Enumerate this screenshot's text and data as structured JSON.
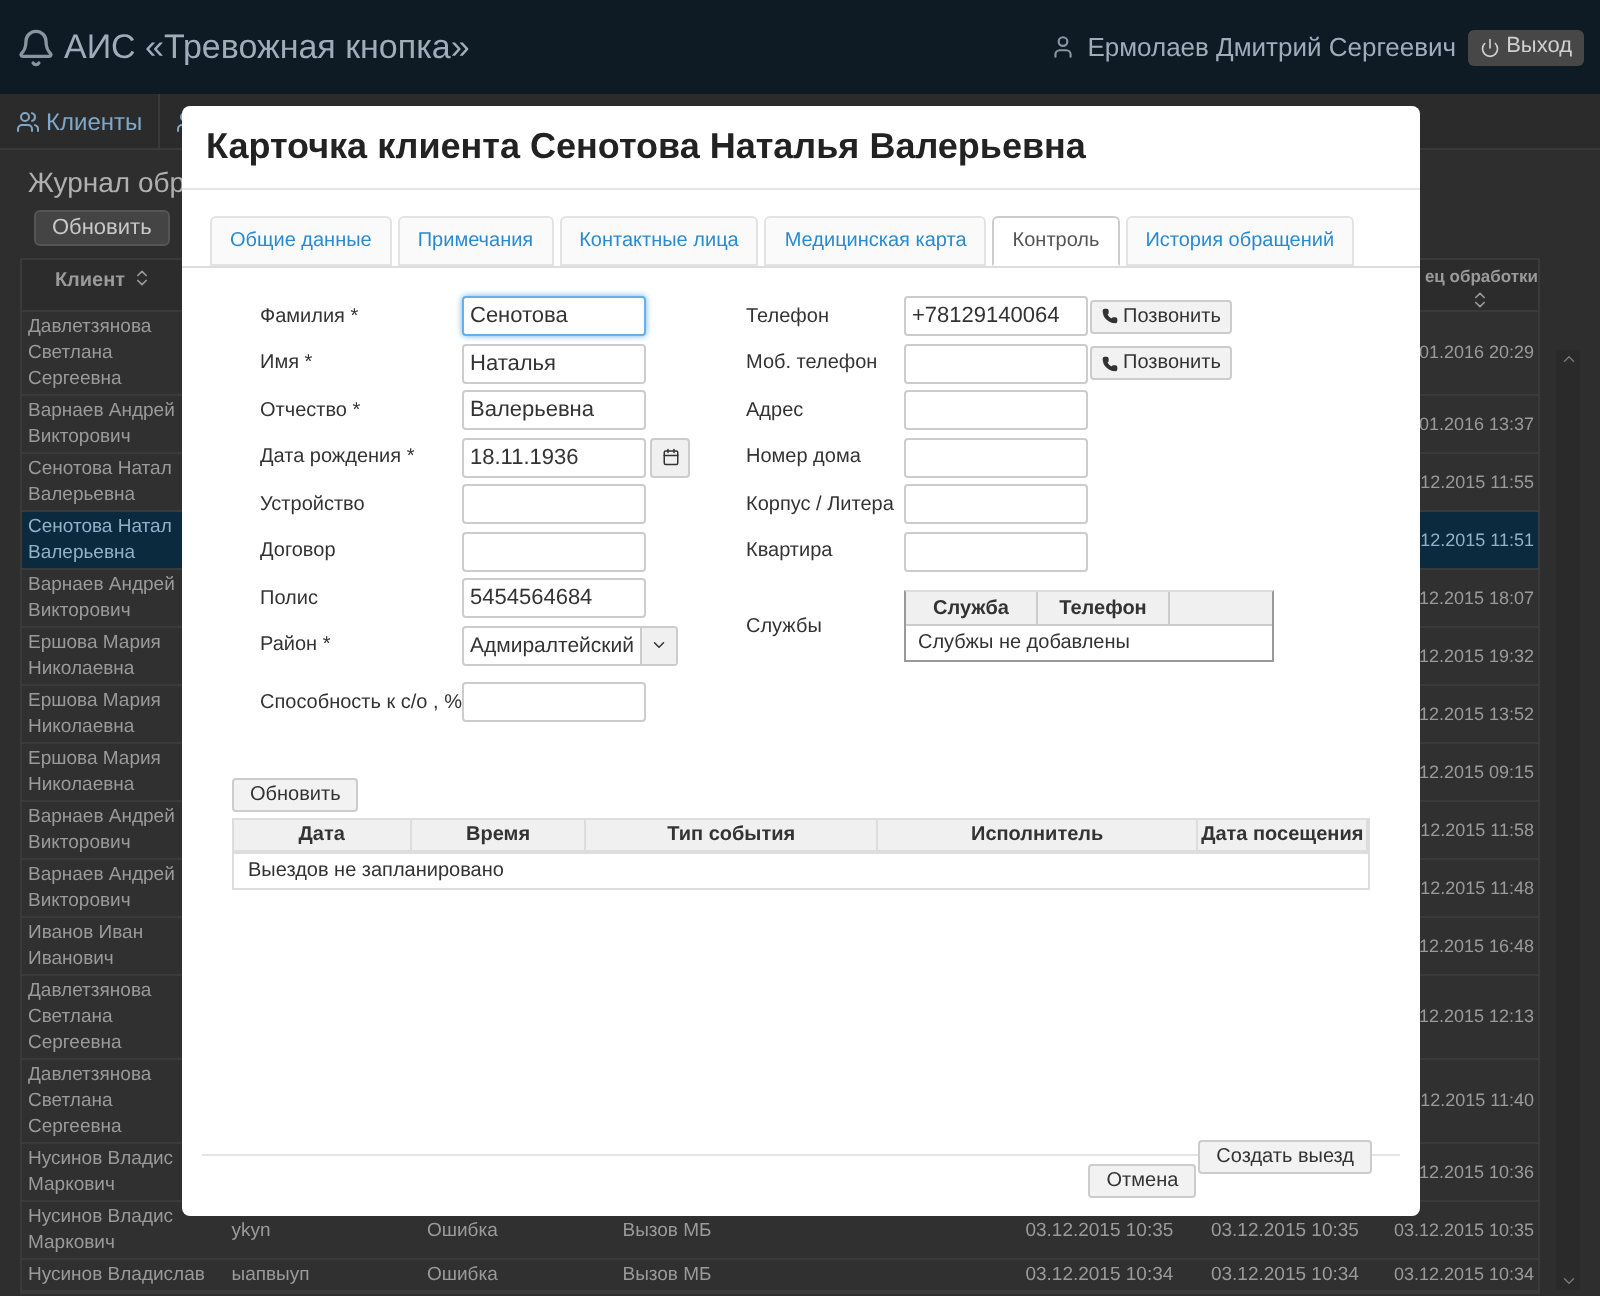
{
  "app": {
    "title": "АИС «Тревожная кнопка»",
    "user": "Ермолаев Дмитрий Сергеевич",
    "logout": "Выход"
  },
  "nav": {
    "items": [
      {
        "label": "Клиенты",
        "selected": true
      }
    ]
  },
  "journal": {
    "title": "Журнал обр",
    "refresh": "Обновить",
    "client_header": "Клиент",
    "end_header": "ец обработки",
    "rows": [
      {
        "client": [
          "Давлетзянова",
          "Светлана",
          "Сергеевна"
        ],
        "selected": false,
        "end": "01.2016 20:29"
      },
      {
        "client": [
          "Варнаев Андрей",
          "Викторович"
        ],
        "selected": false,
        "end": "01.2016 13:37"
      },
      {
        "client": [
          "Сенотова Натал",
          "Валерьевна"
        ],
        "selected": false,
        "end": "12.2015 11:55"
      },
      {
        "client": [
          "Сенотова Натал",
          "Валерьевна"
        ],
        "selected": true,
        "end": "12.2015 11:51"
      },
      {
        "client": [
          "Варнаев Андрей",
          "Викторович"
        ],
        "selected": false,
        "end": "12.2015 18:07"
      },
      {
        "client": [
          "Ершова Мария",
          "Николаевна"
        ],
        "selected": false,
        "end": "12.2015 19:32"
      },
      {
        "client": [
          "Ершова Мария",
          "Николаевна"
        ],
        "selected": false,
        "end": "12.2015 13:52"
      },
      {
        "client": [
          "Ершова Мария",
          "Николаевна"
        ],
        "selected": false,
        "end": "12.2015 09:15"
      },
      {
        "client": [
          "Варнаев Андрей",
          "Викторович"
        ],
        "selected": false,
        "end": "12.2015 11:58"
      },
      {
        "client": [
          "Варнаев Андрей",
          "Викторович"
        ],
        "selected": false,
        "end": "12.2015 11:48"
      },
      {
        "client": [
          "Иванов Иван",
          "Иванович"
        ],
        "selected": false,
        "end": "12.2015 16:48"
      },
      {
        "client": [
          "Давлетзянова",
          "Светлана",
          "Сергеевна"
        ],
        "selected": false,
        "end": "12.2015 12:13"
      },
      {
        "client": [
          "Давлетзянова",
          "Светлана",
          "Сергеевна"
        ],
        "selected": false,
        "end": "12.2015 11:40"
      },
      {
        "client": [
          "Нусинов Владис",
          "Маркович"
        ],
        "selected": false,
        "end": "12.2015 10:36"
      },
      {
        "client": [
          "Нусинов Владис",
          "Маркович"
        ],
        "selected": false,
        "cells": [
          "ykyn",
          "Ошибка",
          "Вызов МБ",
          "",
          "03.12.2015 10:35",
          "03.12.2015 10:35"
        ],
        "end": "03.12.2015 10:35"
      },
      {
        "client": [
          "Нусинов Владислав"
        ],
        "selected": false,
        "cells": [
          "ыапвыуп",
          "Ошибка",
          "Вызов МБ",
          "",
          "03.12.2015 10:34",
          "03.12.2015 10:34"
        ],
        "end": "03.12.2015 10:34"
      }
    ]
  },
  "modal": {
    "title": "Карточка клиента Сенотова Наталья Валерьевна",
    "tabs": [
      {
        "label": "Общие данные",
        "selected": false
      },
      {
        "label": "Примечания",
        "selected": false
      },
      {
        "label": "Контактные лица",
        "selected": false
      },
      {
        "label": "Медицинская карта",
        "selected": false
      },
      {
        "label": "Контроль",
        "selected": true
      },
      {
        "label": "История обращений",
        "selected": false
      }
    ],
    "left_fields": [
      {
        "label": "Фамилия *",
        "kind": "text",
        "value": "Сенотова",
        "focused": true
      },
      {
        "label": "Имя *",
        "kind": "text",
        "value": "Наталья",
        "focused": false
      },
      {
        "label": "Отчество *",
        "kind": "text",
        "value": "Валерьевна",
        "focused": false
      },
      {
        "label": "Дата рождения *",
        "kind": "date",
        "value": "18.11.1936",
        "focused": false
      },
      {
        "label": "Устройство",
        "kind": "text",
        "focused": false
      },
      {
        "label": "Договор",
        "kind": "text",
        "focused": false
      },
      {
        "label": "Полис",
        "kind": "text",
        "value": "5454564684",
        "focused": false
      },
      {
        "label": "Район *",
        "kind": "select",
        "value": "Адмиралтейский",
        "focused": false
      },
      {
        "label": "Способность к с/о , %",
        "kind": "text",
        "focused": false
      }
    ],
    "right_fields": [
      {
        "label": "Телефон",
        "value": "+78129140064",
        "call_button": "Позвонить"
      },
      {
        "label": "Моб. телефон",
        "call_button": "Позвонить"
      },
      {
        "label": "Адрес"
      },
      {
        "label": "Номер дома"
      },
      {
        "label": "Корпус / Литера"
      },
      {
        "label": "Квартира"
      }
    ],
    "services": {
      "label": "Службы",
      "columns": [
        "Служба",
        "Телефон"
      ],
      "empty": "Слубжы не добавлены"
    },
    "refresh": "Обновить",
    "events": {
      "columns": [
        "Дата",
        "Время",
        "Тип события",
        "Исполнитель",
        "Дата посещения"
      ],
      "empty": "Выездов не запланировано"
    },
    "create": "Создать выезд",
    "cancel": "Отмена"
  }
}
